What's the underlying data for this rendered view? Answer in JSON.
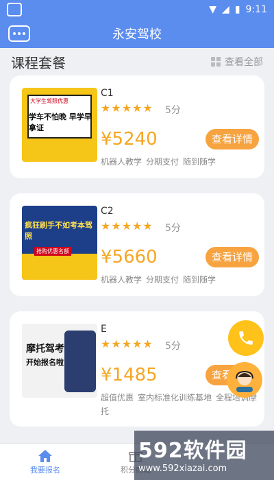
{
  "status": {
    "time": "9:11"
  },
  "header": {
    "title": "永安驾校"
  },
  "section": {
    "title": "课程套餐",
    "view_all": "查看全部"
  },
  "courses": [
    {
      "name": "C1",
      "score": "5分",
      "price": "¥5240",
      "detail": "查看详情",
      "tags": [
        "机器人教学",
        "分期支付",
        "随到随学"
      ],
      "poster_line1": "大学生驾照优惠",
      "poster_line2": "学车不怕晚 早学早拿证"
    },
    {
      "name": "C2",
      "score": "5分",
      "price": "¥5660",
      "detail": "查看详情",
      "tags": [
        "机器人教学",
        "分期支付",
        "随到随学"
      ],
      "poster_line1": "疯狂刷手不如考本驾照",
      "poster_line2": "抢购优惠名额"
    },
    {
      "name": "E",
      "score": "5分",
      "price": "¥1485",
      "detail": "查看详情",
      "tags": [
        "超值优惠",
        "室内标准化训练基地",
        "全程培训摩托"
      ],
      "poster_line1": "摩托驾考",
      "poster_line2": "开始报名啦"
    }
  ],
  "nav": {
    "home": "我要报名",
    "points": "积分商城"
  },
  "watermark": {
    "big": "592软件园",
    "small": "www.592xiazai.com"
  },
  "colors": {
    "primary": "#5b8def",
    "accent": "#f5a623"
  }
}
